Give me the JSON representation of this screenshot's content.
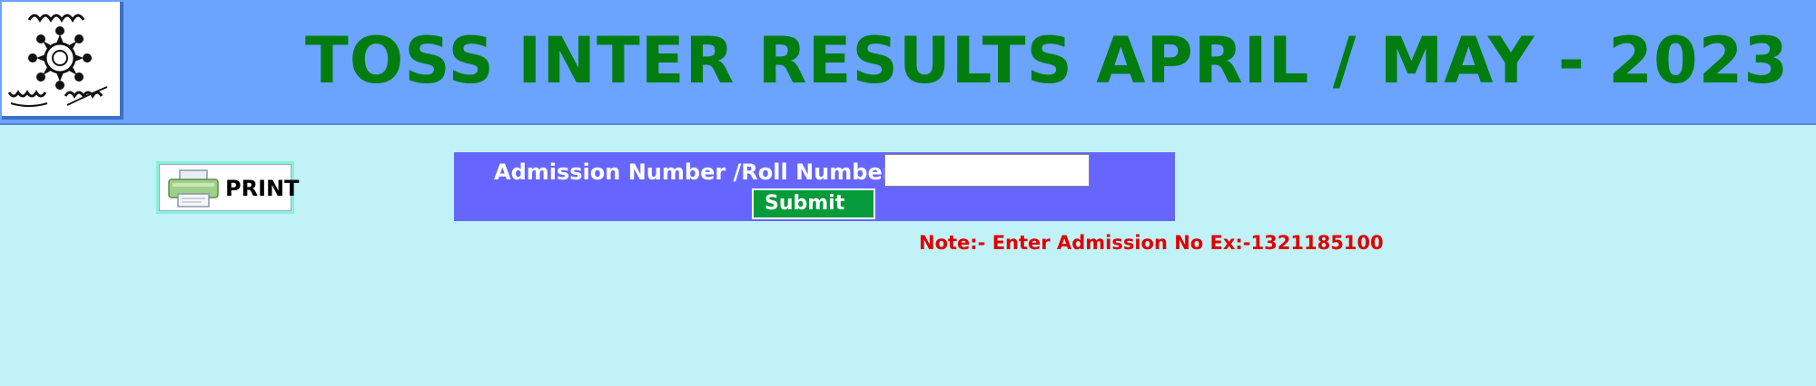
{
  "header": {
    "title": "TOSS INTER RESULTS APRIL / MAY - 2023",
    "logo_icon": "toss-emblem-icon",
    "background_color": "#6aa4ff",
    "title_color": "#037d0f"
  },
  "print": {
    "label": "PRINT",
    "icon": "printer-icon"
  },
  "form": {
    "label": "Admission Number /Roll Number  :",
    "input_value": "",
    "input_placeholder": "",
    "submit_label": "Submit",
    "panel_color": "#6666ff",
    "submit_color": "#079a3a"
  },
  "note": {
    "text": "Note:- Enter Admission No Ex:-1321185100",
    "color": "#e00000"
  },
  "page": {
    "background_color": "#c0f2f7"
  }
}
